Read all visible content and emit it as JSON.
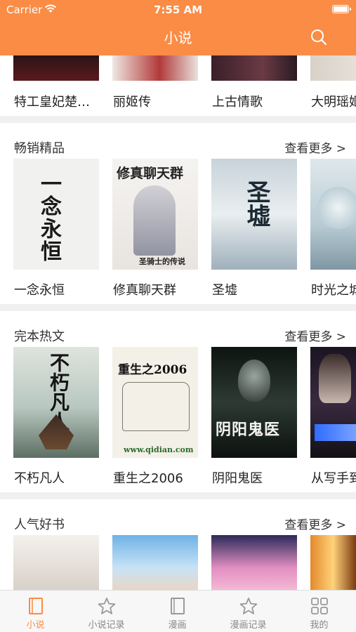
{
  "status_bar": {
    "carrier": "Carrier",
    "time": "7:55 AM"
  },
  "header": {
    "title": "小说",
    "search_icon": "search-icon"
  },
  "top_row": {
    "books": [
      {
        "title": "特工皇妃楚…"
      },
      {
        "title": "丽姬传"
      },
      {
        "title": "上古情歌"
      },
      {
        "title": "大明瑶姬"
      }
    ]
  },
  "sections": [
    {
      "title": "畅销精品",
      "more": "查看更多 >",
      "books": [
        {
          "title": "一念永恒",
          "cover_text": "一念永恒"
        },
        {
          "title": "修真聊天群",
          "cover_text": "修真聊天群",
          "cover_sub": "圣骑士的传说"
        },
        {
          "title": "圣墟",
          "cover_text": "圣墟"
        },
        {
          "title": "时光之城"
        }
      ]
    },
    {
      "title": "完本热文",
      "more": "查看更多 >",
      "books": [
        {
          "title": "不朽凡人",
          "cover_text": "不朽凡人"
        },
        {
          "title": "重生之2006",
          "cover_text": "重生之2006",
          "cover_sub": "www.qidian.com"
        },
        {
          "title": "阴阳鬼医",
          "cover_text": "阴阳鬼医"
        },
        {
          "title": "从写手到"
        }
      ]
    },
    {
      "title": "人气好书",
      "more": "查看更多 >",
      "books": [
        {},
        {},
        {},
        {}
      ]
    }
  ],
  "tabbar": {
    "tabs": [
      {
        "label": "小说",
        "icon": "book-icon",
        "active": true
      },
      {
        "label": "小说记录",
        "icon": "star-icon"
      },
      {
        "label": "漫画",
        "icon": "book-icon"
      },
      {
        "label": "漫画记录",
        "icon": "star-icon"
      },
      {
        "label": "我的",
        "icon": "grid-icon"
      }
    ]
  },
  "colors": {
    "accent": "#fb8c45",
    "divider": "#f0f0f0",
    "tab_inactive": "#888888"
  }
}
